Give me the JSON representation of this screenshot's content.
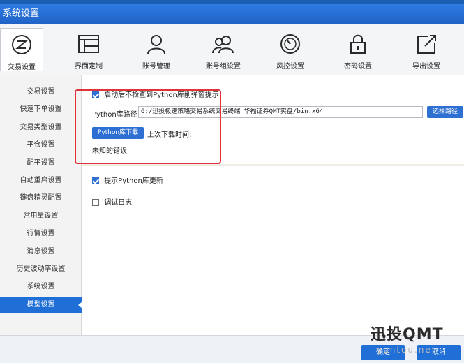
{
  "window": {
    "title": "系统设置"
  },
  "toolbar": {
    "items": [
      {
        "label": "交易设置",
        "icon": "trade-z-icon",
        "active": true
      },
      {
        "label": "界面定制",
        "icon": "layout-grid-icon"
      },
      {
        "label": "账号管理",
        "icon": "user-icon"
      },
      {
        "label": "账号组设置",
        "icon": "user-group-icon"
      },
      {
        "label": "风控设置",
        "icon": "gauge-icon"
      },
      {
        "label": "密码设置",
        "icon": "lock-icon"
      },
      {
        "label": "导出设置",
        "icon": "export-icon"
      }
    ]
  },
  "sidebar": {
    "items": [
      {
        "label": "交易设置"
      },
      {
        "label": "快速下单设置"
      },
      {
        "label": "交易类型设置"
      },
      {
        "label": "平仓设置"
      },
      {
        "label": "配平设置"
      },
      {
        "label": "自动重启设置"
      },
      {
        "label": "键盘精灵配置"
      },
      {
        "label": "常用量设置"
      },
      {
        "label": "行情设置"
      },
      {
        "label": "消息设置"
      },
      {
        "label": "历史波动率设置"
      },
      {
        "label": "系统设置"
      },
      {
        "label": "模型设置",
        "active": true
      }
    ]
  },
  "content": {
    "startup_check_label": "启动后不检查到Python库削弹窗提示",
    "startup_check_checked": true,
    "path_label": "Python库路径",
    "path_value": "G:/迅投极速策略交易系统交易终端 华福证券QMT实盘/bin.x64",
    "choose_path_button": "选择路径",
    "download_button": "Python库下载",
    "last_download_label": "上次下载时间:",
    "error_text": "未知的错误",
    "update_prompt_label": "提示Python库更新",
    "update_prompt_checked": true,
    "debug_log_label": "调试日志",
    "debug_log_checked": false
  },
  "footer": {
    "ok_button": "确定",
    "cancel_button": "取消"
  },
  "watermark": {
    "brand": "迅投QMT",
    "site": "yuntou.net"
  },
  "colors": {
    "accent": "#1f6fd6",
    "title_bar": "#2f7be3",
    "highlight_box": "#e0323a"
  }
}
